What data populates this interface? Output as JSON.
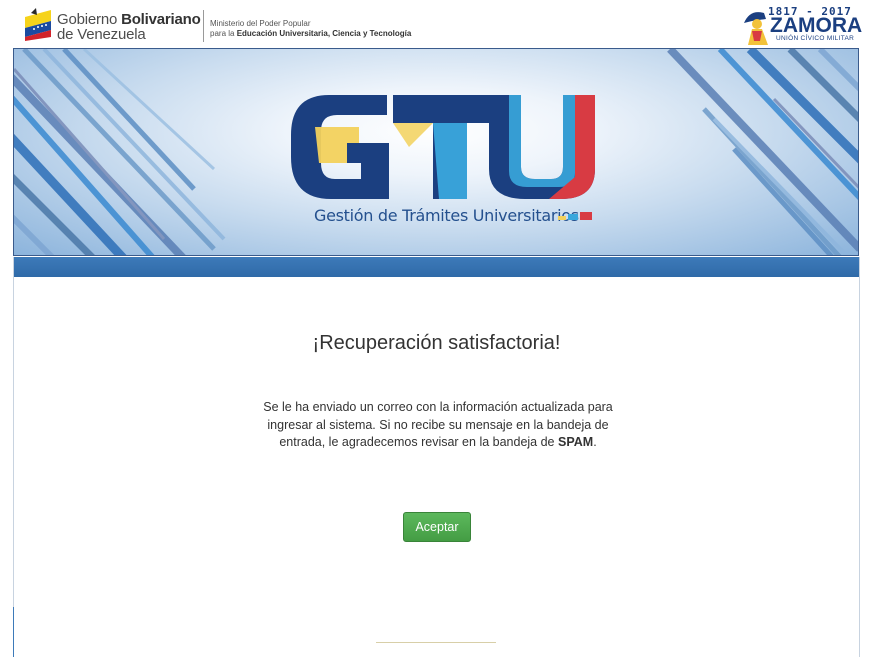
{
  "header": {
    "gov_name_regular": "Gobierno ",
    "gov_name_bold": "Bolivariano",
    "gov_name_line2": "de Venezuela",
    "ministry_line1": "Ministerio del Poder Popular",
    "ministry_line2_prefix": "para la ",
    "ministry_line2_bold": "Educación Universitaria, Ciencia y Tecnología",
    "zamora_years": "1817 - 2017",
    "zamora_name": "ZAMORA",
    "zamora_sub": "UNIÓN CÍVICO MILITAR"
  },
  "banner": {
    "logo_text": "GTU",
    "subtitle": "Gestión de Trámites Universitarios"
  },
  "main": {
    "title": "¡Recuperación satisfactoria!",
    "message_text": "Se le ha enviado un correo con la información actualizada para ingresar al sistema. Si no recibe su mensaje en la bandeja de entrada, le agradecemos revisar en la bandeja de",
    "message_bold": "SPAM",
    "message_end": ".",
    "accept_label": "Aceptar"
  },
  "colors": {
    "bar_blue": "#2f6aa8",
    "button_green": "#449d44",
    "gtu_blue": "#1b3f80",
    "gtu_yellow": "#f2d15c",
    "gtu_cyan": "#3aa7dc",
    "gtu_red": "#d83b43"
  },
  "icons": [
    "venezuela-shield-icon",
    "zamora-figure-icon",
    "gtu-logo"
  ]
}
